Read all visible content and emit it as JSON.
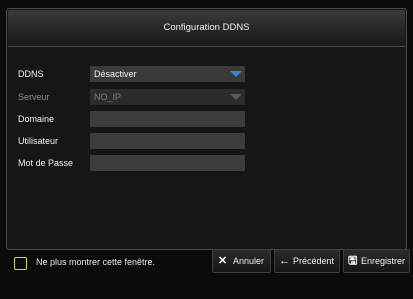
{
  "dialog": {
    "title": "Configuration DDNS"
  },
  "form": {
    "ddns": {
      "label": "DDNS",
      "value": "Désactiver"
    },
    "serveur": {
      "label": "Serveur",
      "value": "NO_IP"
    },
    "domaine": {
      "label": "Domaine",
      "value": ""
    },
    "utilisateur": {
      "label": "Utilisateur",
      "value": ""
    },
    "mot_de_passe": {
      "label": "Mot de Passe",
      "value": ""
    }
  },
  "footer": {
    "checkbox_label": "Ne plus montrer cette fenêtre.",
    "annuler": "Annuler",
    "precedent": "Précédent",
    "enregistrer": "Enregistrer"
  },
  "icons": {
    "annuler": "close-icon",
    "precedent": "arrow-left-icon",
    "enregistrer": "save-icon",
    "dropdown": "chevron-down-icon"
  },
  "colors": {
    "accent": "#2d8ad8",
    "checkbox": "#c4d44a"
  }
}
